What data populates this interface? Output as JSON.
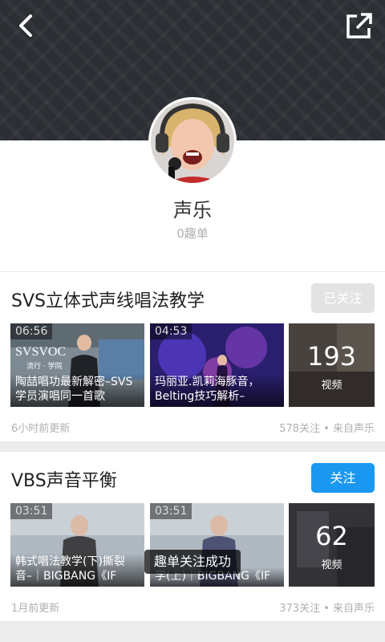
{
  "header": {
    "back_icon": "chevron-left-icon",
    "share_icon": "share-external-icon"
  },
  "profile": {
    "name": "声乐",
    "subtitle": "0趣单"
  },
  "cards": [
    {
      "title": "SVS立体式声线唱法教学",
      "follow_label": "已关注",
      "follow_state": "followed",
      "videos": [
        {
          "duration": "06:56",
          "caption": "陶喆唱功最新解密–SVS学员演唱同一首歌"
        },
        {
          "duration": "04:53",
          "caption": "玛丽亚.凯莉海豚音，Belting技巧解析–"
        }
      ],
      "video_count": "193",
      "video_count_label": "视频",
      "updated": "6小时前更新",
      "followers": "578关注 • 来自声乐"
    },
    {
      "title": "VBS声音平衡",
      "follow_label": "关注",
      "follow_state": "active",
      "videos": [
        {
          "duration": "03:51",
          "caption": "韩式唱法教学(下)撕裂音–｜BIGBANG《IF"
        },
        {
          "duration": "03:51",
          "caption": "学(上)｜BIGBANG《IF"
        }
      ],
      "video_count": "62",
      "video_count_label": "视频",
      "updated": "1月前更新",
      "followers": "373关注 • 来自声乐"
    }
  ],
  "toast": "趣单关注成功",
  "colors": {
    "accent": "#1a98f0",
    "header_bg": "#2b2e33",
    "muted_text": "#b0b0b0"
  }
}
